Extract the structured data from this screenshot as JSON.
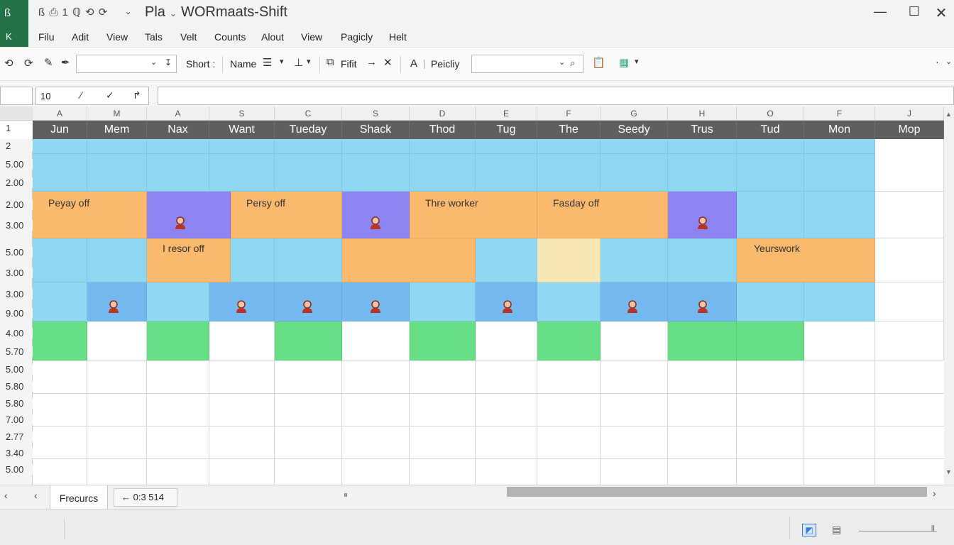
{
  "window": {
    "quick_access": "ß ⎙ 1 ℚ ⟲ ⟳",
    "title_prefix": "Pla",
    "title": "WORmaats-Shift",
    "app_glyph_top": "ß",
    "app_glyph_bottom": "K"
  },
  "menu": [
    "Filu",
    "Adit",
    "View",
    "Tals",
    "Velt",
    "Counts",
    "Alout",
    "View",
    "Pagicly",
    "Helt"
  ],
  "toolbar": {
    "short_label": "Short :",
    "name_label": "Name",
    "fifit_label": "Fifit",
    "font_a": "A",
    "peicliy_label": "Peicliy",
    "dot": "·"
  },
  "formula": {
    "name_box_value": "10"
  },
  "columns": [
    "A",
    "M",
    "A",
    "S",
    "C",
    "S",
    "D",
    "E",
    "F",
    "G",
    "H",
    "O",
    "F",
    "J"
  ],
  "days": [
    "Jun",
    "Mem",
    "Nax",
    "Want",
    "Tueday",
    "Shack",
    "Thod",
    "Tug",
    "The",
    "Seedy",
    "Trus",
    "Tud",
    "Mon",
    "Mop"
  ],
  "rows": [
    "1",
    "2",
    "5.00",
    "2.00",
    "2.00",
    "3.00",
    "5.00",
    "3.00",
    "3.00",
    "9.00",
    "4.00",
    "5.70",
    "5.00",
    "5.80",
    "5.80",
    "7.00",
    "2.77",
    "3.40",
    "5.00"
  ],
  "events": {
    "e1": "Peyay off",
    "e2": "Persy off",
    "e3": "Thre worker",
    "e4": "Fasday off",
    "e5": "I resor off",
    "e6": "Yeurswork"
  },
  "sheet": {
    "tab_label": "Frecurcs",
    "position": "0:3 514",
    "back_arrow": "←"
  },
  "colors": {
    "accent": "#217346",
    "header": "#5f5f5f",
    "shift_blue": "#8fd8f1",
    "shift_orange": "#fbb96d",
    "shift_purple": "#8b84f2",
    "shift_green": "#66de85"
  }
}
